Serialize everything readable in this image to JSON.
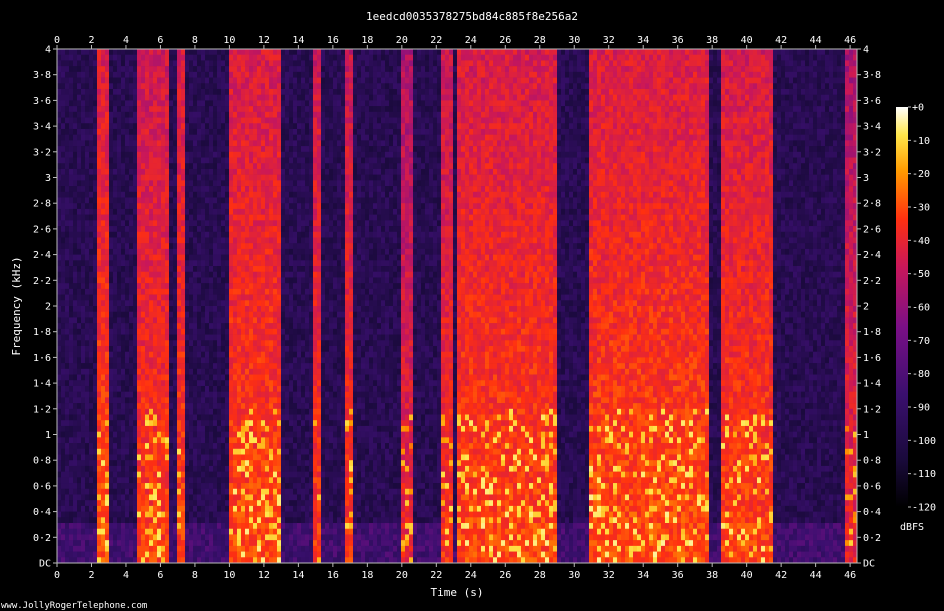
{
  "chart_data": {
    "type": "heatmap",
    "title": "1eedcd0035378275bd84c885f8e256a2",
    "xlabel": "Time (s)",
    "ylabel": "Frequency (kHz)",
    "colorbar_label": "dBFS",
    "credit": "www.JollyRogerTelephone.com",
    "xlim": [
      0,
      46.4
    ],
    "ylim": [
      0,
      4
    ],
    "x_ticks": [
      "0",
      "2",
      "4",
      "6",
      "8",
      "10",
      "12",
      "14",
      "16",
      "18",
      "20",
      "22",
      "24",
      "26",
      "28",
      "30",
      "32",
      "34",
      "36",
      "38",
      "40",
      "42",
      "44",
      "46"
    ],
    "y_ticks": [
      "DC",
      "0·2",
      "0·4",
      "0·6",
      "0·8",
      "1",
      "1·2",
      "1·4",
      "1·6",
      "1·8",
      "2",
      "2·2",
      "2·4",
      "2·6",
      "2·8",
      "3",
      "3·2",
      "3·4",
      "3·6",
      "3·8",
      "4"
    ],
    "colorbar_ticks": [
      "+0",
      "-10",
      "-20",
      "-30",
      "-40",
      "-50",
      "-60",
      "-70",
      "-80",
      "-90",
      "-100",
      "-110",
      "-120"
    ],
    "colorbar_range": [
      -120,
      0
    ],
    "colors": [
      "#000000",
      "#1a0a3c",
      "#3a0f6e",
      "#7a0f86",
      "#c8175a",
      "#ff3010",
      "#ff9a00",
      "#ffe64a",
      "#ffffff"
    ],
    "speech_segments": [
      {
        "start": 2.4,
        "end": 2.9,
        "level": 0.85
      },
      {
        "start": 4.7,
        "end": 6.5,
        "level": 0.75
      },
      {
        "start": 7.0,
        "end": 7.4,
        "level": 0.8
      },
      {
        "start": 10.0,
        "end": 12.9,
        "level": 0.82
      },
      {
        "start": 14.8,
        "end": 15.3,
        "level": 0.75
      },
      {
        "start": 16.6,
        "end": 17.2,
        "level": 0.72
      },
      {
        "start": 20.0,
        "end": 20.7,
        "level": 0.55
      },
      {
        "start": 22.3,
        "end": 22.9,
        "level": 0.7
      },
      {
        "start": 23.2,
        "end": 29.0,
        "level": 0.82
      },
      {
        "start": 30.9,
        "end": 37.9,
        "level": 0.85
      },
      {
        "start": 38.6,
        "end": 41.6,
        "level": 0.8
      },
      {
        "start": 45.7,
        "end": 46.3,
        "level": 0.55
      }
    ]
  }
}
